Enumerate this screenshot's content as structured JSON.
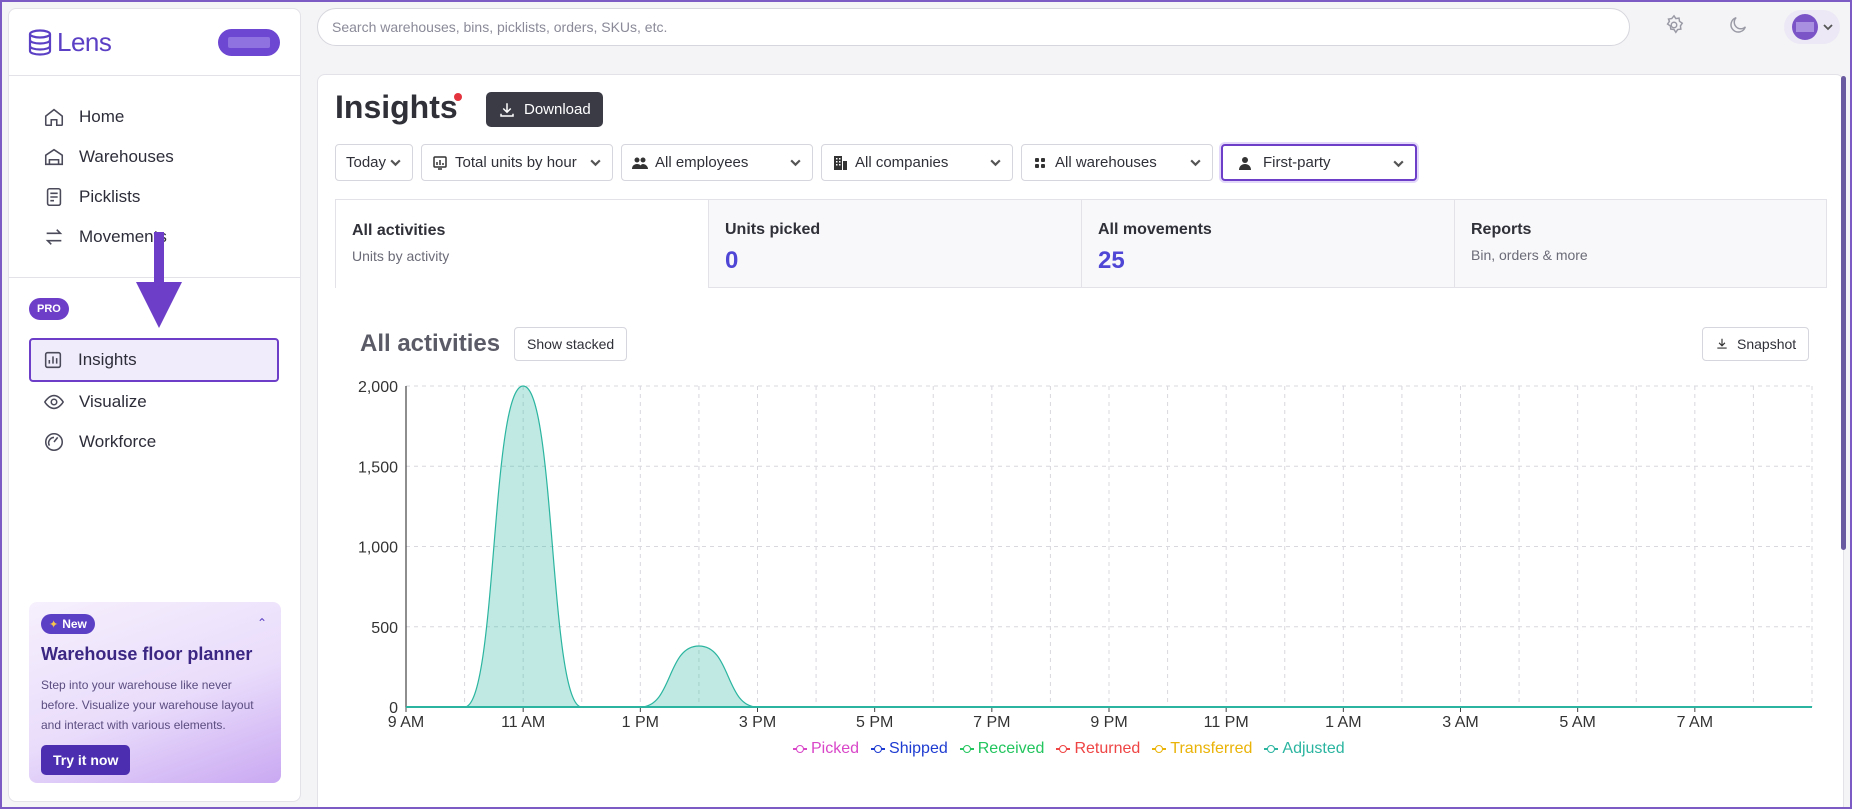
{
  "brand": {
    "name": "Lens"
  },
  "search": {
    "placeholder": "Search warehouses, bins, picklists, orders, SKUs, etc."
  },
  "sidebar": {
    "items": [
      {
        "label": "Home",
        "icon": "home-icon"
      },
      {
        "label": "Warehouses",
        "icon": "warehouse-icon"
      },
      {
        "label": "Picklists",
        "icon": "picklist-icon"
      },
      {
        "label": "Movements",
        "icon": "arrows-icon"
      }
    ],
    "pro_label": "PRO",
    "pro_items": [
      {
        "label": "Insights",
        "icon": "chart-icon",
        "active": true
      },
      {
        "label": "Visualize",
        "icon": "eye-icon"
      },
      {
        "label": "Workforce",
        "icon": "gauge-icon"
      }
    ],
    "promo": {
      "badge": "New",
      "title": "Warehouse floor planner",
      "text": "Step into your warehouse like never before. Visualize your warehouse layout and interact with various elements.",
      "button": "Try it now"
    }
  },
  "header": {
    "title": "Insights",
    "download_label": "Download"
  },
  "filters": [
    {
      "label": "Today",
      "icon": ""
    },
    {
      "label": "Total units by hour",
      "icon": "chart-filter-icon"
    },
    {
      "label": "All employees",
      "icon": "users-icon"
    },
    {
      "label": "All companies",
      "icon": "building-icon"
    },
    {
      "label": "All warehouses",
      "icon": "grid-icon"
    },
    {
      "label": "First-party",
      "icon": "person-icon",
      "selected": true
    }
  ],
  "tabs": [
    {
      "title": "All activities",
      "subtitle": "Units by activity",
      "active": true
    },
    {
      "title": "Units picked",
      "value": "0"
    },
    {
      "title": "All movements",
      "value": "25"
    },
    {
      "title": "Reports",
      "subtitle": "Bin, orders & more"
    }
  ],
  "chart_section": {
    "title": "All activities",
    "stacked_label": "Show stacked",
    "snapshot_label": "Snapshot"
  },
  "chart_data": {
    "type": "area",
    "x": [
      "9 AM",
      "10 AM",
      "11 AM",
      "12 PM",
      "1 PM",
      "2 PM",
      "3 PM",
      "4 PM",
      "5 PM",
      "6 PM",
      "7 PM",
      "8 PM",
      "9 PM",
      "10 PM",
      "11 PM",
      "12 AM",
      "1 AM",
      "2 AM",
      "3 AM",
      "4 AM",
      "5 AM",
      "6 AM",
      "7 AM",
      "8 AM"
    ],
    "tick_labels": [
      "9 AM",
      "11 AM",
      "1 PM",
      "3 PM",
      "5 PM",
      "7 PM",
      "9 PM",
      "11 PM",
      "1 AM",
      "3 AM",
      "5 AM",
      "7 AM"
    ],
    "ylim": [
      0,
      2000
    ],
    "yticks": [
      "0",
      "500",
      "1,000",
      "1,500",
      "2,000"
    ],
    "ytick_values": [
      0,
      500,
      1000,
      1500,
      2000
    ],
    "series": [
      {
        "name": "Picked",
        "color": "#d946c8",
        "values": [
          0,
          0,
          0,
          0,
          0,
          0,
          0,
          0,
          0,
          0,
          0,
          0,
          0,
          0,
          0,
          0,
          0,
          0,
          0,
          0,
          0,
          0,
          0,
          0
        ]
      },
      {
        "name": "Shipped",
        "color": "#1d3bd1",
        "values": [
          0,
          0,
          0,
          0,
          0,
          0,
          0,
          0,
          0,
          0,
          0,
          0,
          0,
          0,
          0,
          0,
          0,
          0,
          0,
          0,
          0,
          0,
          0,
          0
        ]
      },
      {
        "name": "Received",
        "color": "#22c55e",
        "values": [
          0,
          0,
          0,
          0,
          0,
          0,
          0,
          0,
          0,
          0,
          0,
          0,
          0,
          0,
          0,
          0,
          0,
          0,
          0,
          0,
          0,
          0,
          0,
          0
        ]
      },
      {
        "name": "Returned",
        "color": "#ef4444",
        "values": [
          0,
          0,
          0,
          0,
          0,
          0,
          0,
          0,
          0,
          0,
          0,
          0,
          0,
          0,
          0,
          0,
          0,
          0,
          0,
          0,
          0,
          0,
          0,
          0
        ]
      },
      {
        "name": "Transferred",
        "color": "#eab308",
        "values": [
          0,
          0,
          0,
          0,
          0,
          0,
          0,
          0,
          0,
          0,
          0,
          0,
          0,
          0,
          0,
          0,
          0,
          0,
          0,
          0,
          0,
          0,
          0,
          0
        ]
      },
      {
        "name": "Adjusted",
        "color": "#2bb5a0",
        "values": [
          0,
          0,
          2000,
          0,
          0,
          380,
          0,
          0,
          0,
          0,
          0,
          0,
          0,
          0,
          0,
          0,
          0,
          0,
          0,
          0,
          0,
          0,
          0,
          0
        ]
      }
    ],
    "grid": true,
    "legend": "bottom"
  }
}
